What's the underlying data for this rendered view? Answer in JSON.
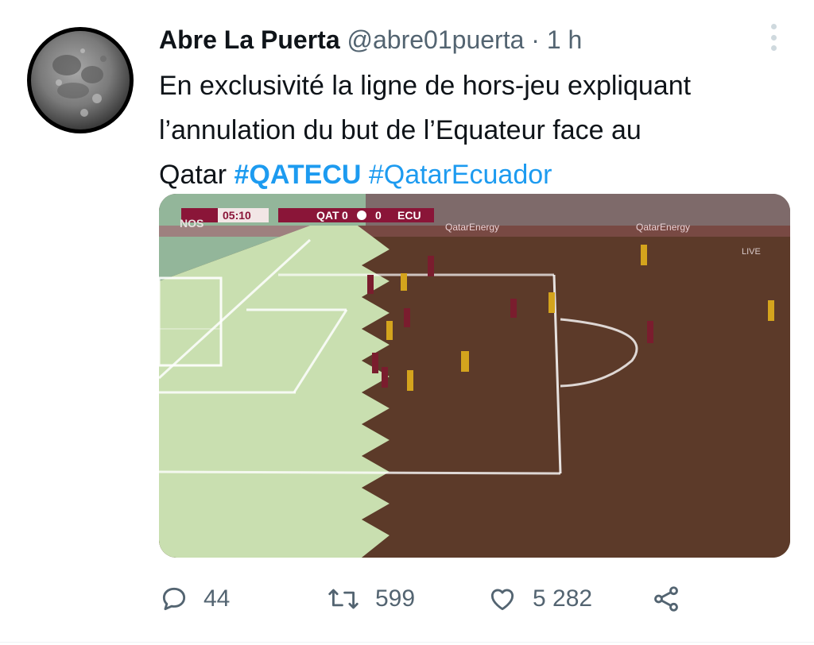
{
  "tweet": {
    "author": {
      "name": "Abre La Puerta",
      "handle": "@abre01puerta",
      "separator": "·",
      "time": "1 h"
    },
    "text": {
      "line1": "En exclusivité la ligne de hors-jeu expliquant",
      "line2": "l’annulation du but de l’Equateur face au",
      "line3_prefix": "Qatar ",
      "hashtag1": "#QATECU",
      "hashtag2": "#QatarEcuador"
    },
    "media": {
      "scoreboard": {
        "clock": "05:10",
        "team1": "QAT",
        "score1": "0",
        "score2": "0",
        "team2": "ECU"
      },
      "broadcaster": "NOS",
      "live_label": "LIVE",
      "ad_text": "QatarEnergy"
    },
    "actions": {
      "replies": "44",
      "retweets": "599",
      "likes": "5 282"
    }
  },
  "colors": {
    "link": "#1d9bf0",
    "secondary_text": "#536471",
    "qatar_maroon": "#8a1538"
  },
  "icons": {
    "reply": "reply-icon",
    "retweet": "retweet-icon",
    "like": "heart-icon",
    "share": "share-icon",
    "more": "more-vertical-icon"
  }
}
